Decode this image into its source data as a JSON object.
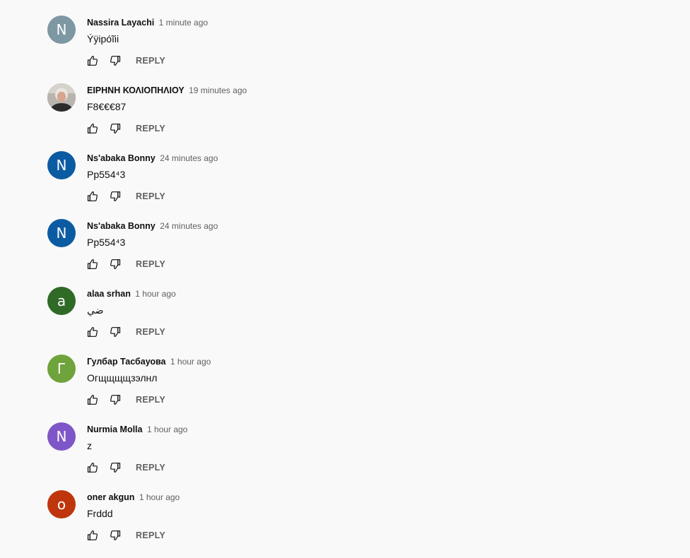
{
  "icons": {
    "like": "thumbs-up-icon",
    "dislike": "thumbs-down-icon"
  },
  "reply_label": "REPLY",
  "comments": [
    {
      "author": "Nassira Layachi",
      "time": "1 minute ago",
      "text": "Ýÿipóĩii",
      "avatar_letter": "N",
      "avatar_color": "#7d97a3"
    },
    {
      "author": "ΕΙΡΗΝΗ ΚΟΛΙΟΠΗΛΙΟΥ",
      "time": "19 minutes ago",
      "text": "F8€€€87",
      "avatar_letter": "",
      "avatar_color": "#8a8a8a",
      "avatar_photo": true
    },
    {
      "author": "Ns'abaka Bonny",
      "time": "24 minutes ago",
      "text": "Pp554⁴3",
      "avatar_letter": "N",
      "avatar_color": "#0b5ba3"
    },
    {
      "author": "Ns'abaka Bonny",
      "time": "24 minutes ago",
      "text": "Pp554⁴3",
      "avatar_letter": "N",
      "avatar_color": "#0b5ba3"
    },
    {
      "author": "alaa srhan",
      "time": "1 hour ago",
      "text": "ضي",
      "avatar_letter": "a",
      "avatar_color": "#2f6a27"
    },
    {
      "author": "Гулбар Тасбауова",
      "time": "1 hour ago",
      "text": "Огщщщщзэлнл",
      "avatar_letter": "Г",
      "avatar_color": "#6fa33b"
    },
    {
      "author": "Nurmia Molla",
      "time": "1 hour ago",
      "text": "z",
      "avatar_letter": "N",
      "avatar_color": "#7f56c7"
    },
    {
      "author": "oner akgun",
      "time": "1 hour ago",
      "text": "Frddd",
      "avatar_letter": "o",
      "avatar_color": "#bf360c"
    }
  ]
}
